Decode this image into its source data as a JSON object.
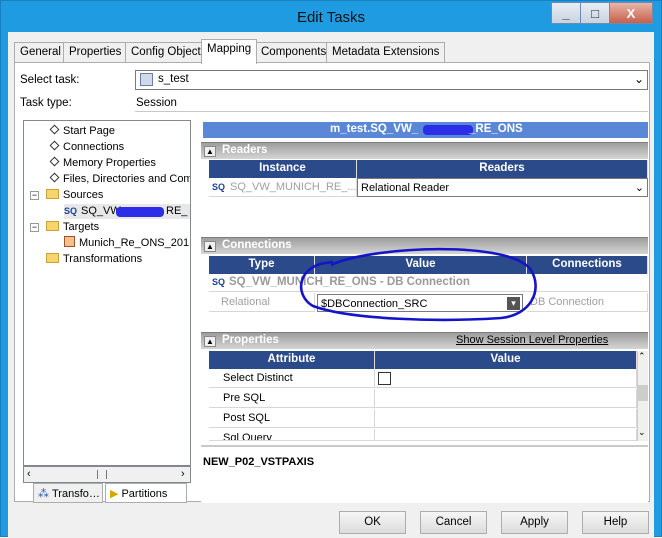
{
  "window": {
    "title": "Edit Tasks",
    "minimize": "_",
    "maximize": "□",
    "close": "X"
  },
  "tabs": [
    "General",
    "Properties",
    "Config Object",
    "Mapping",
    "Components",
    "Metadata Extensions"
  ],
  "select_task_label": "Select task:",
  "select_task_value": "s_test",
  "task_type_label": "Task type:",
  "task_type_value": "Session",
  "tree": {
    "items": [
      "Start Page",
      "Connections",
      "Memory Properties",
      "Files, Directories and Com"
    ],
    "sources": {
      "label": "Sources",
      "child": "SQ_VW_"
    },
    "sources_child_suffix": "RE_",
    "targets": {
      "label": "Targets",
      "child": "Munich_Re_ONS_201"
    },
    "transformations": "Transformations"
  },
  "bottom_tabs": [
    "Transfo…",
    "Partitions"
  ],
  "mapping_title_left": "m_test.SQ_VW_",
  "mapping_title_right": "_RE_ONS",
  "readers": {
    "title": "Readers",
    "headers": [
      "Instance",
      "Readers"
    ],
    "row": {
      "instance": "SQ_VW_MUNICH_RE_...",
      "reader": "Relational Reader"
    }
  },
  "connections": {
    "title": "Connections",
    "headers": [
      "Type",
      "Value",
      "Connections"
    ],
    "group": "SQ_VW_MUNICH_RE_ONS - DB Connection",
    "row": {
      "type": "Relational",
      "value": "$DBConnection_SRC",
      "conn": "DB Connection"
    }
  },
  "properties": {
    "title": "Properties",
    "link": "Show Session Level Properties",
    "headers": [
      "Attribute",
      "Value"
    ],
    "rows": [
      "Select Distinct",
      "Pre SQL",
      "Post SQL",
      "Sql Query"
    ]
  },
  "status_text": "NEW_P02_VSTPAXIS",
  "buttons": [
    "OK",
    "Cancel",
    "Apply",
    "Help"
  ],
  "colors": {
    "accent": "#1e9be1",
    "grid_header": "#2a4a8a",
    "annotation": "#1414c8"
  }
}
